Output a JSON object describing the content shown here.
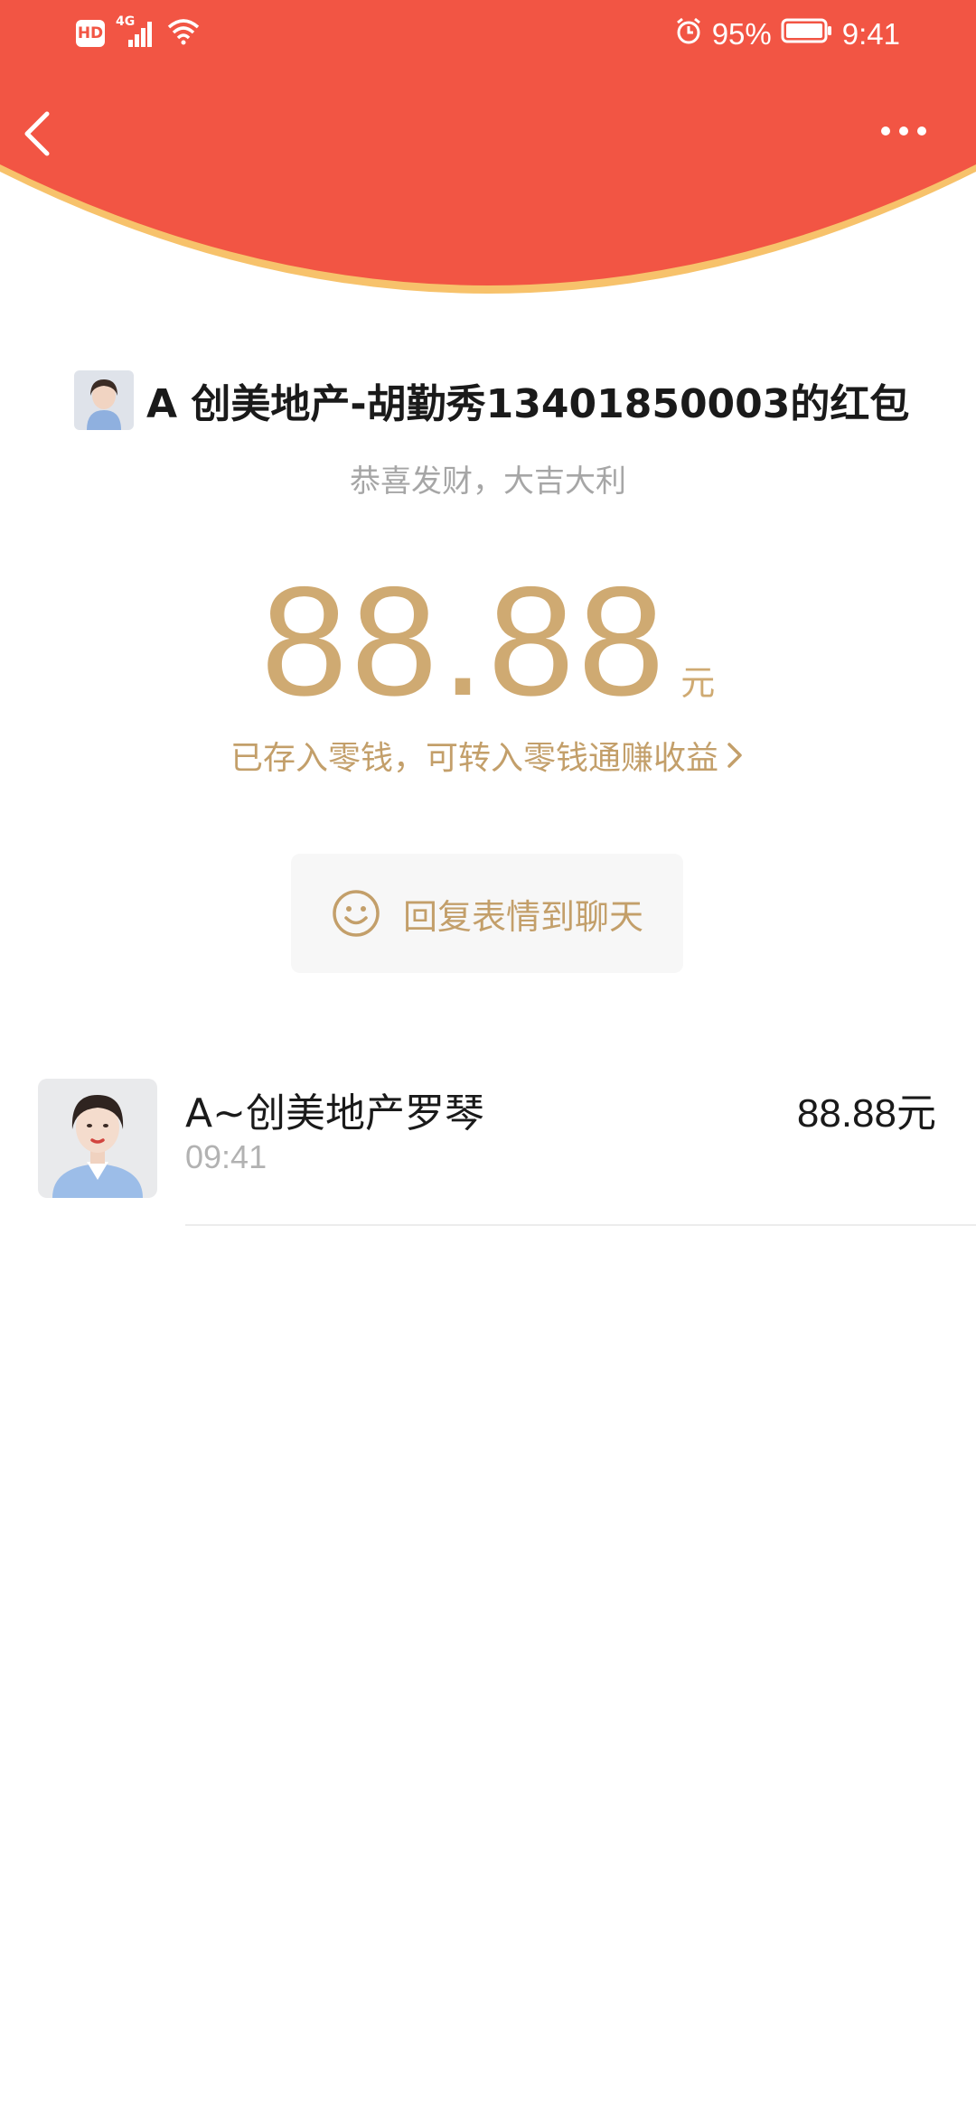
{
  "status_bar": {
    "network": "4G",
    "hd": "HD",
    "battery": "95%",
    "time": "9:41"
  },
  "header": {
    "colors": {
      "red": "#f25544",
      "rim": "#f7c26b"
    }
  },
  "packet": {
    "sender": "A 创美地产-胡勤秀13401850003的红包",
    "greeting": "恭喜发财，大吉大利",
    "amount": "88.88",
    "unit": "元",
    "deposit_note": "已存入零钱，可转入零钱通赚收益",
    "reply_label": "回复表情到聊天",
    "accent": "#cfaa72"
  },
  "records": [
    {
      "name": "A~创美地产罗琴",
      "time": "09:41",
      "amount": "88.88元"
    }
  ]
}
